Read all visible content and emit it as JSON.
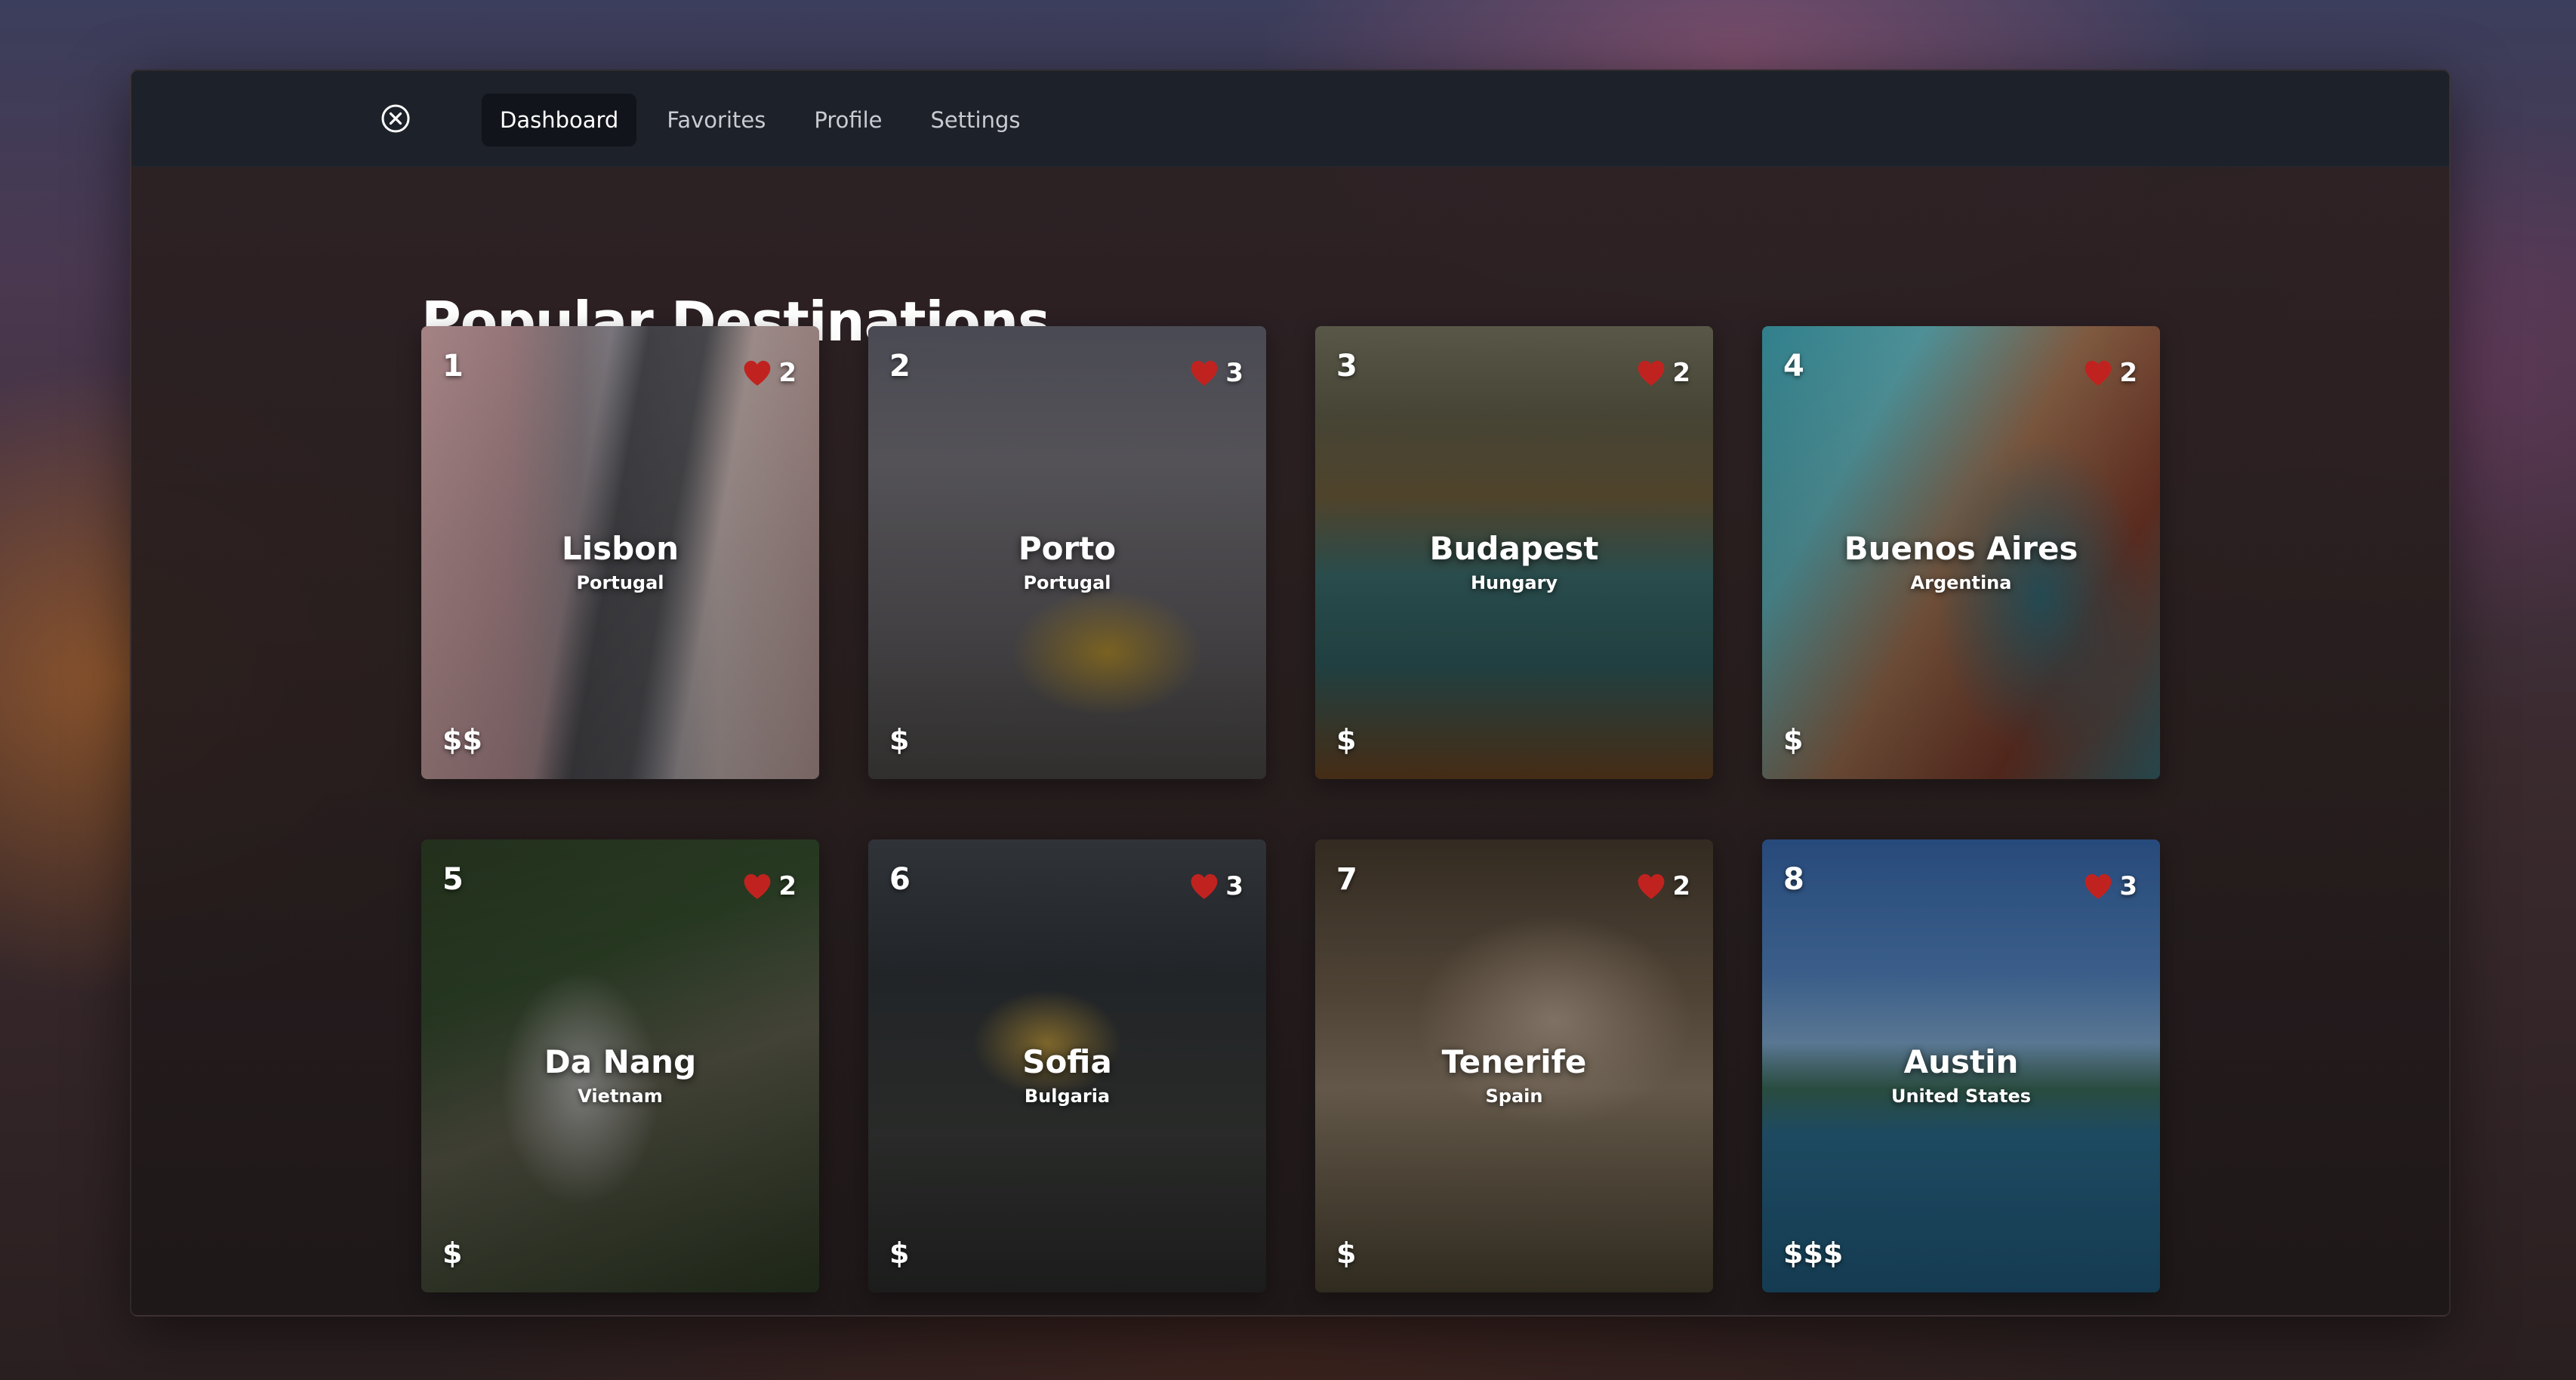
{
  "nav": {
    "close_icon": "close-circle-icon",
    "tabs": [
      {
        "label": "Dashboard",
        "active": true
      },
      {
        "label": "Favorites",
        "active": false
      },
      {
        "label": "Profile",
        "active": false
      },
      {
        "label": "Settings",
        "active": false
      }
    ]
  },
  "main": {
    "title": "Popular Destinations"
  },
  "heart_color": "#c0231f",
  "destinations": [
    {
      "rank": "1",
      "city": "Lisbon",
      "country": "Portugal",
      "likes": "2",
      "price": "$$"
    },
    {
      "rank": "2",
      "city": "Porto",
      "country": "Portugal",
      "likes": "3",
      "price": "$"
    },
    {
      "rank": "3",
      "city": "Budapest",
      "country": "Hungary",
      "likes": "2",
      "price": "$"
    },
    {
      "rank": "4",
      "city": "Buenos Aires",
      "country": "Argentina",
      "likes": "2",
      "price": "$"
    },
    {
      "rank": "5",
      "city": "Da Nang",
      "country": "Vietnam",
      "likes": "2",
      "price": "$"
    },
    {
      "rank": "6",
      "city": "Sofia",
      "country": "Bulgaria",
      "likes": "3",
      "price": "$"
    },
    {
      "rank": "7",
      "city": "Tenerife",
      "country": "Spain",
      "likes": "2",
      "price": "$"
    },
    {
      "rank": "8",
      "city": "Austin",
      "country": "United States",
      "likes": "3",
      "price": "$$$"
    }
  ]
}
